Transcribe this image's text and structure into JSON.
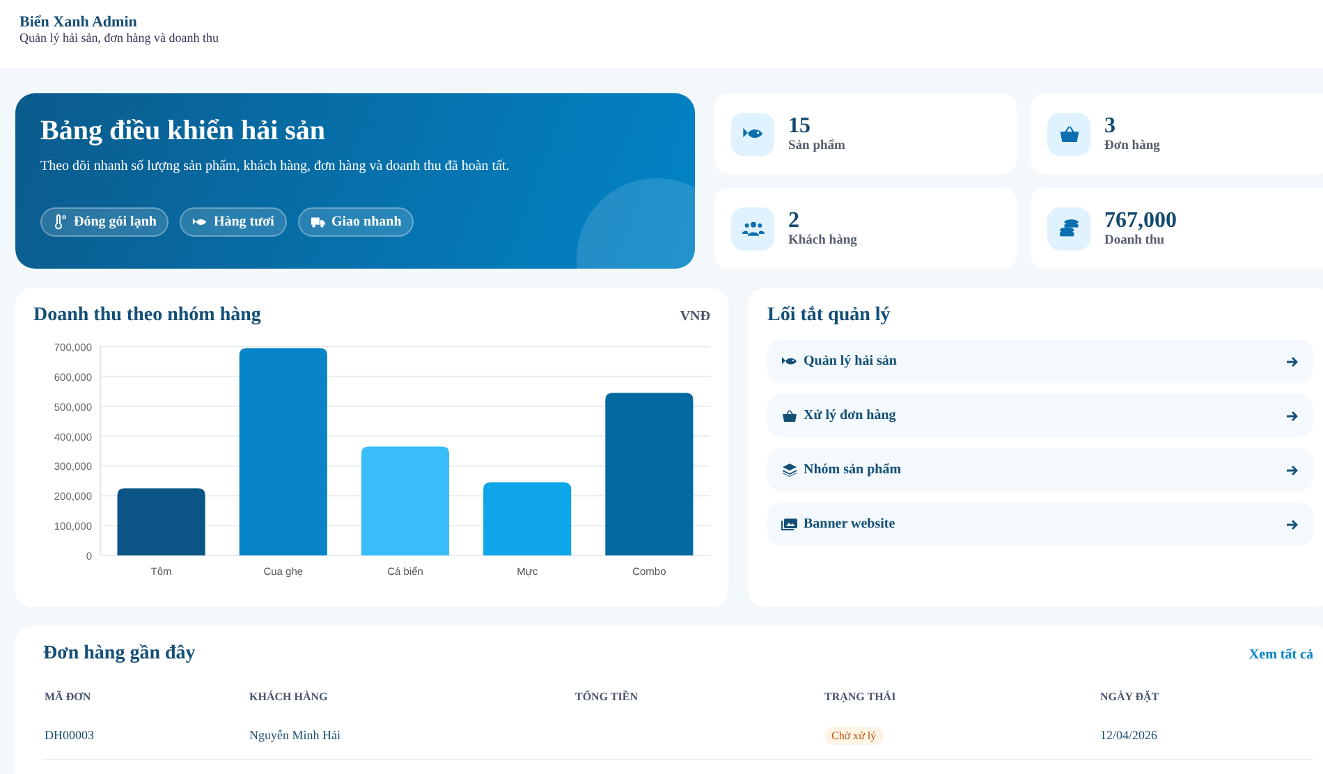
{
  "header": {
    "brand": "Biển Xanh Admin",
    "subtitle": "Quản lý hải sản, đơn hàng và doanh thu"
  },
  "hero": {
    "title": "Bảng điều khiển hải sản",
    "description": "Theo dõi nhanh số lượng sản phẩm, khách hàng, đơn hàng và doanh thu đã hoàn tất.",
    "tags": [
      {
        "kind": "cold",
        "label": "Đóng gói lạnh"
      },
      {
        "kind": "fish",
        "label": "Hàng tươi"
      },
      {
        "kind": "truck",
        "label": "Giao nhanh"
      }
    ]
  },
  "stats": [
    {
      "kind": "fish",
      "value": "15",
      "label": "Sản phẩm"
    },
    {
      "kind": "basket",
      "value": "3",
      "label": "Đơn hàng"
    },
    {
      "kind": "users",
      "value": "2",
      "label": "Khách hàng"
    },
    {
      "kind": "coins",
      "value": "767,000",
      "label": "Doanh thu"
    }
  ],
  "revenue": {
    "title": "Doanh thu theo nhóm hàng",
    "unit": "VNĐ",
    "chart_data": {
      "type": "bar",
      "categories": [
        "Tôm",
        "Cua ghẹ",
        "Cá biển",
        "Mực",
        "Combo"
      ],
      "series": [
        {
          "values": [
            225000,
            695000,
            365000,
            245000,
            545000
          ]
        }
      ],
      "grid": true,
      "ylim": [
        0,
        700000
      ],
      "yticks": [
        {
          "value": 0,
          "label": "0"
        },
        {
          "value": 100000,
          "label": "100,000"
        },
        {
          "value": 200000,
          "label": "200,000"
        },
        {
          "value": 300000,
          "label": "300,000"
        },
        {
          "value": 400000,
          "label": "400,000"
        },
        {
          "value": 500000,
          "label": "500,000"
        },
        {
          "value": 600000,
          "label": "600,000"
        },
        {
          "value": 700000,
          "label": "700,000"
        }
      ]
    }
  },
  "shortcuts": {
    "title": "Lối tắt quản lý",
    "items": [
      {
        "kind": "fish",
        "label": "Quản lý hải sản"
      },
      {
        "kind": "basket",
        "label": "Xử lý đơn hàng"
      },
      {
        "kind": "layers",
        "label": "Nhóm sản phẩm"
      },
      {
        "kind": "images",
        "label": "Banner website"
      }
    ]
  },
  "orders": {
    "title": "Đơn hàng gần đây",
    "link": "Xem tất cả",
    "columns": [
      "MÃ ĐƠN",
      "KHÁCH HÀNG",
      "TỔNG TIỀN",
      "TRẠNG THÁI",
      "NGÀY ĐẶT"
    ],
    "rows": [
      {
        "code": "DH00003",
        "customer": "Nguyễn Minh Hải",
        "status": "Chờ xử lý",
        "kind": "pending",
        "date": "12/04/2026"
      }
    ]
  }
}
